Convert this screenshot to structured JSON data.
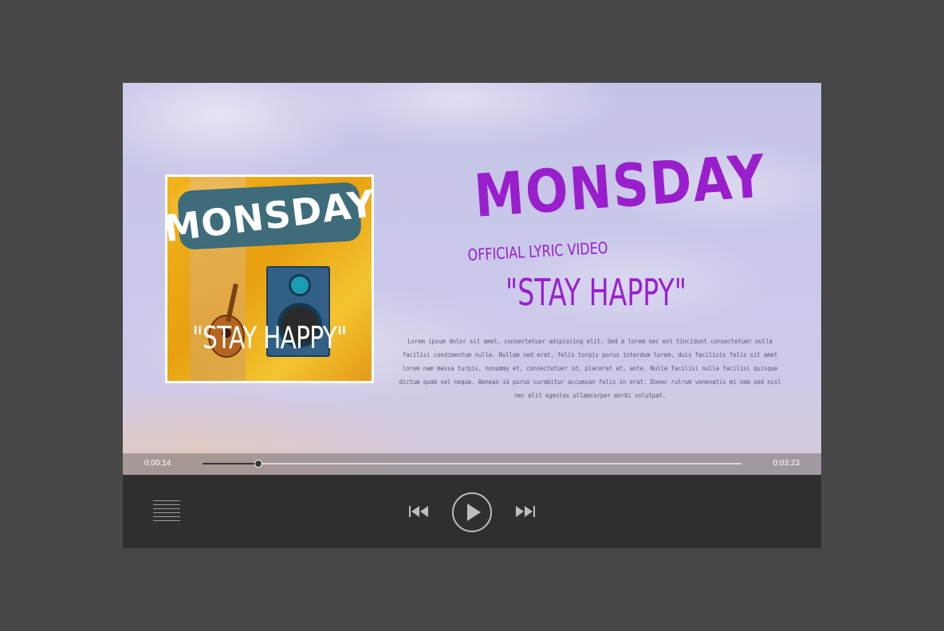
{
  "cover": {
    "title": "MONSDAY",
    "subtitle": "\"STAY HAPPY\""
  },
  "header": {
    "title": "MONSDAY",
    "tagline": "OFFICIAL LYRIC VIDEO",
    "song": "\"STAY HAPPY\""
  },
  "description": "Lorem ipsum dolor sit amet, consectetuer adipiscing elit. Sed a lorem nec est tincidunt consectetuer nulla facilisi condimentum nulla. Nullam sed erat, felis turpis purus interdum lorem, duis facilisis felis sit amet lorem nam massa turpis, nonummy et, consectetuer id, placerat at, ante. Nulla facilisi nulla facilisi quisque dictum quam vel neque. Aenean id purus curabitur accumsan felis in erat. Donec rutrum venenatis mi nam sed nisl nec elit egestas ullamcorper morbi volutpat.",
  "player": {
    "current_time": "0:00:14",
    "total_time": "0:03:23",
    "progress": 0.104
  },
  "colors": {
    "accent": "#9a1fcc",
    "background": "#474747",
    "controls": "#2f2f2f"
  },
  "icons": {
    "menu": "menu-icon",
    "previous": "skip-previous-icon",
    "play": "play-icon",
    "next": "skip-next-icon"
  }
}
